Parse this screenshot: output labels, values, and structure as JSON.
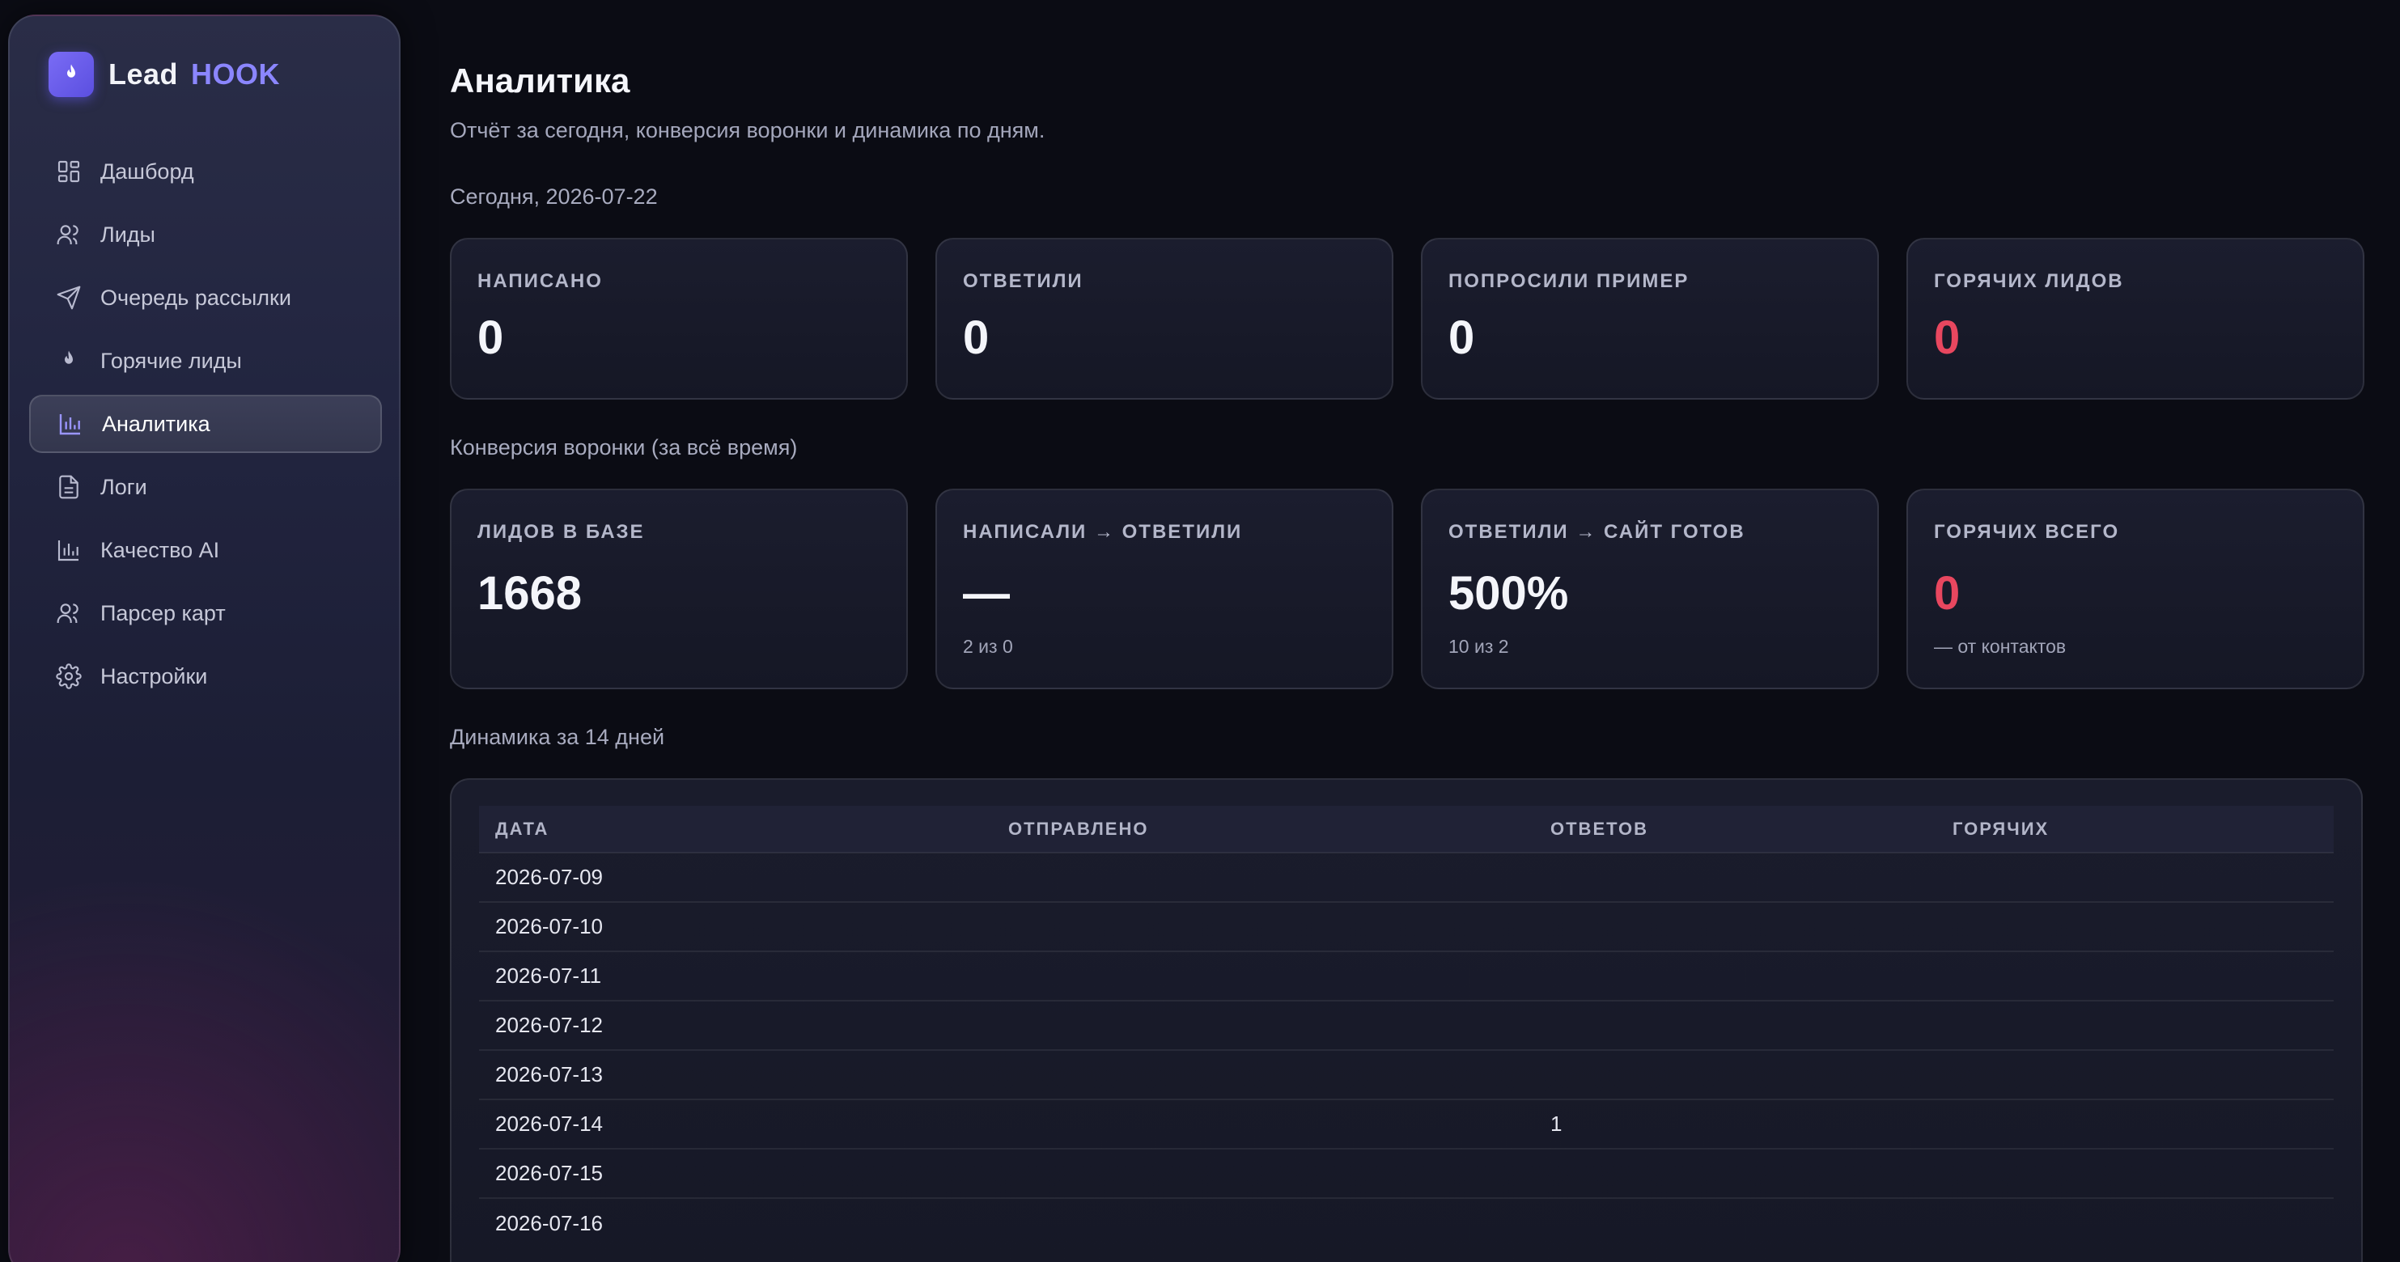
{
  "brand": {
    "lead": "Lead",
    "hook": "HOOK"
  },
  "nav": [
    {
      "label": "Дашборд",
      "icon": "dashboard-icon"
    },
    {
      "label": "Лиды",
      "icon": "users-icon"
    },
    {
      "label": "Очередь рассылки",
      "icon": "send-icon"
    },
    {
      "label": "Горячие лиды",
      "icon": "flame-icon"
    },
    {
      "label": "Аналитика",
      "icon": "bar-chart-icon",
      "active": true
    },
    {
      "label": "Логи",
      "icon": "document-icon"
    },
    {
      "label": "Качество AI",
      "icon": "bar-chart-icon"
    },
    {
      "label": "Парсер карт",
      "icon": "users-icon"
    },
    {
      "label": "Настройки",
      "icon": "gear-icon"
    }
  ],
  "page": {
    "title": "Аналитика",
    "subtitle": "Отчёт за сегодня, конверсия воронки и динамика по дням."
  },
  "today": {
    "label": "Сегодня, 2026-07-22",
    "cards": [
      {
        "key": "НАПИСАНО",
        "value": "0"
      },
      {
        "key": "ОТВЕТИЛИ",
        "value": "0"
      },
      {
        "key": "ПОПРОСИЛИ ПРИМЕР",
        "value": "0"
      },
      {
        "key": "ГОРЯЧИХ ЛИДОВ",
        "value": "0"
      }
    ]
  },
  "funnel": {
    "label": "Конверсия воронки (за всё время)",
    "cards": [
      {
        "key": "ЛИДОВ В БАЗЕ",
        "value": "1668",
        "sub": ""
      },
      {
        "key": "НАПИСАЛИ → ОТВЕТИЛИ",
        "value": "—",
        "sub": "2 из 0"
      },
      {
        "key": "ОТВЕТИЛИ → САЙТ ГОТОВ",
        "value": "500%",
        "sub": "10 из 2"
      },
      {
        "key": "ГОРЯЧИХ ВСЕГО",
        "value": "0",
        "sub": "— от контактов"
      }
    ]
  },
  "dynamics": {
    "label": "Динамика за 14 дней",
    "columns": [
      "ДАТА",
      "ОТПРАВЛЕНО",
      "ОТВЕТОВ",
      "ГОРЯЧИХ"
    ],
    "rows": [
      [
        "2026-07-09",
        "",
        "",
        ""
      ],
      [
        "2026-07-10",
        "",
        "",
        ""
      ],
      [
        "2026-07-11",
        "",
        "",
        ""
      ],
      [
        "2026-07-12",
        "",
        "",
        ""
      ],
      [
        "2026-07-13",
        "",
        "",
        ""
      ],
      [
        "2026-07-14",
        "",
        "1",
        ""
      ],
      [
        "2026-07-15",
        "",
        "",
        ""
      ],
      [
        "2026-07-16",
        "",
        "",
        ""
      ]
    ]
  },
  "colors": {
    "accent": "#8b86ff",
    "hot": "#e8475f",
    "background": "#0b0c14"
  }
}
